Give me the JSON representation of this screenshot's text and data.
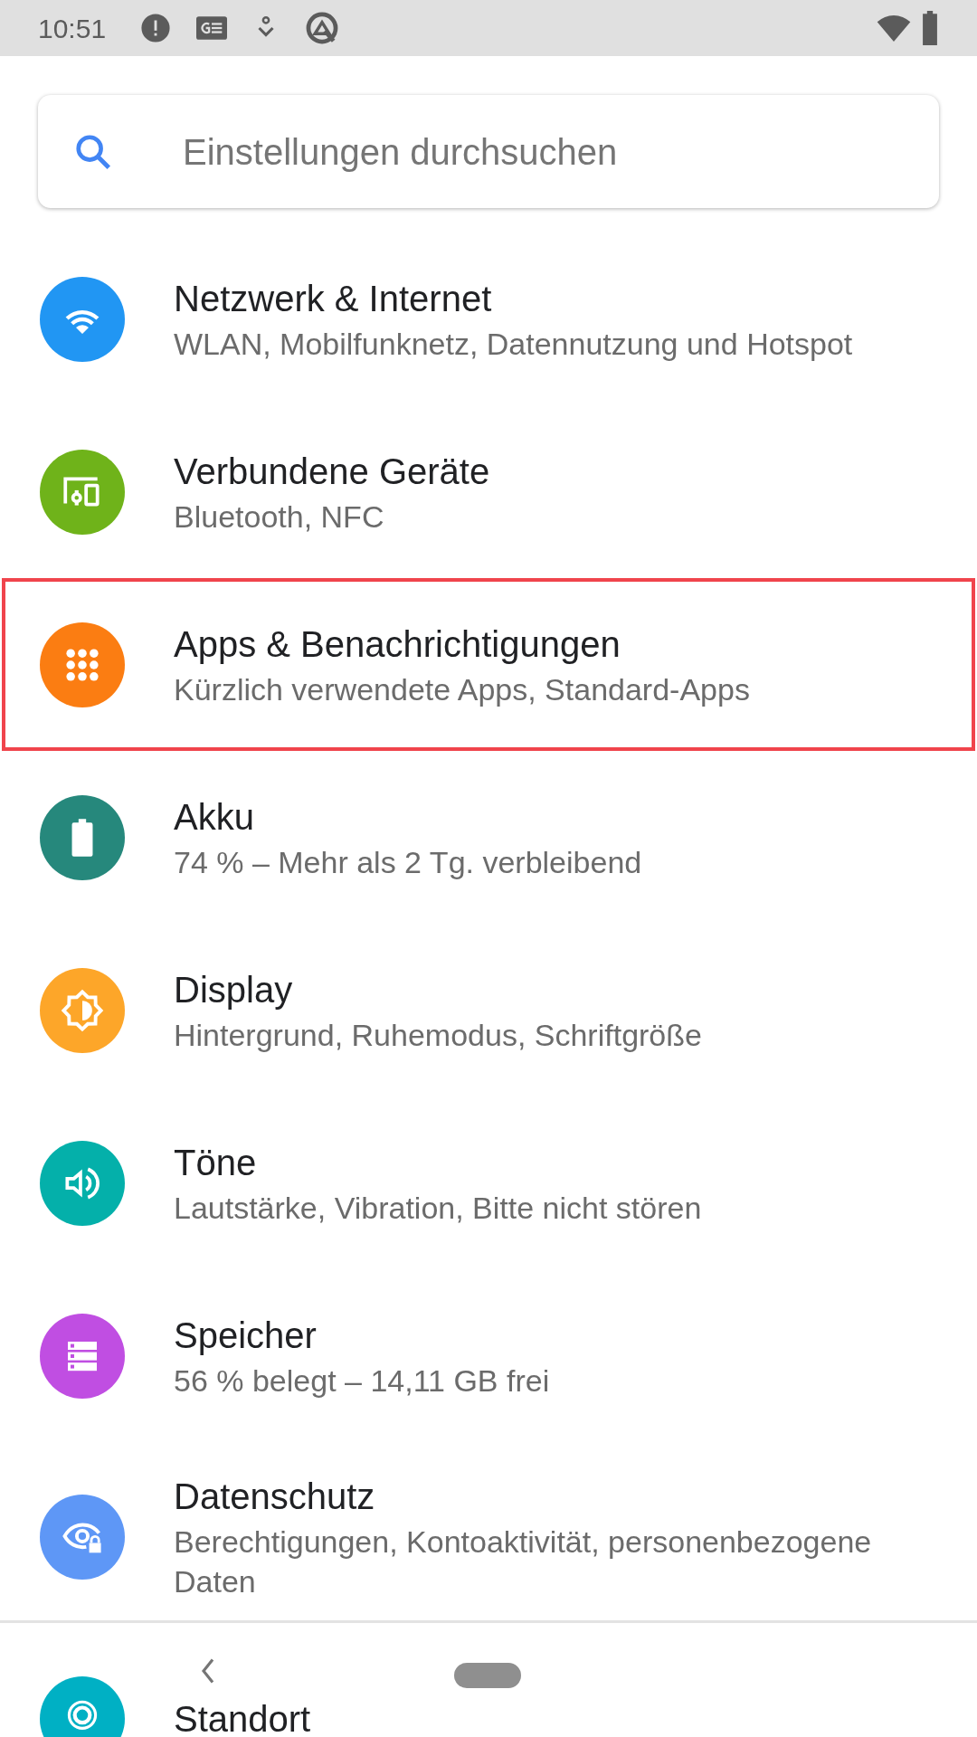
{
  "status_bar": {
    "time": "10:51"
  },
  "search": {
    "placeholder": "Einstellungen durchsuchen"
  },
  "items": [
    {
      "title": "Netzwerk & Internet",
      "subtitle": "WLAN, Mobilfunknetz, Datennutzung und Hotspot",
      "kind": "wifi",
      "color": "#2196f3",
      "highlighted": false
    },
    {
      "title": "Verbundene Geräte",
      "subtitle": "Bluetooth, NFC",
      "kind": "devices",
      "color": "#6fb31a",
      "highlighted": false
    },
    {
      "title": "Apps & Benachrichtigungen",
      "subtitle": "Kürzlich verwendete Apps, Standard-Apps",
      "kind": "apps",
      "color": "#fb7d12",
      "highlighted": true
    },
    {
      "title": "Akku",
      "subtitle": "74 % – Mehr als 2 Tg. verbleibend",
      "kind": "battery",
      "color": "#26887c",
      "highlighted": false
    },
    {
      "title": "Display",
      "subtitle": "Hintergrund, Ruhemodus, Schriftgröße",
      "kind": "brightness",
      "color": "#fda629",
      "highlighted": false
    },
    {
      "title": "Töne",
      "subtitle": "Lautstärke, Vibration, Bitte nicht stören",
      "kind": "volume",
      "color": "#04b0aa",
      "highlighted": false
    },
    {
      "title": "Speicher",
      "subtitle": "56 % belegt – 14,11 GB frei",
      "kind": "storage",
      "color": "#c04ee2",
      "highlighted": false
    },
    {
      "title": "Datenschutz",
      "subtitle": "Berechtigungen, Kontoaktivität, personenbezogene Daten",
      "kind": "privacy",
      "color": "#5e97f6",
      "highlighted": false
    },
    {
      "title": "Standort",
      "kind": "location",
      "color": "#00b0c4",
      "highlighted": false
    }
  ]
}
